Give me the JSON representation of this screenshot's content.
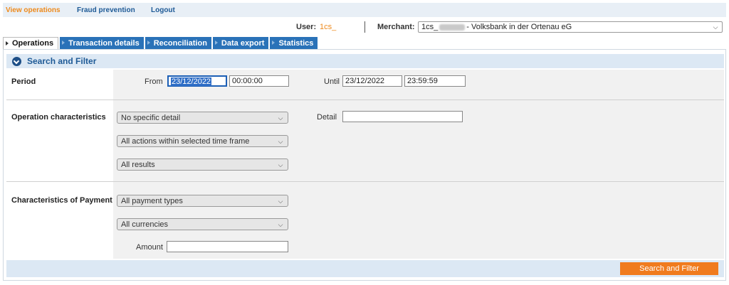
{
  "nav": {
    "items": [
      "View operations",
      "Fraud prevention",
      "Logout"
    ]
  },
  "user": {
    "label": "User:",
    "value": "1cs_"
  },
  "merchant": {
    "label": "Merchant:",
    "prefix": "1cs_",
    "suffix": "- Volksbank in der Ortenau eG"
  },
  "tabs": [
    "Operations",
    "Transaction details",
    "Reconciliation",
    "Data export",
    "Statistics"
  ],
  "search": {
    "header": "Search and Filter",
    "period": {
      "label": "Period",
      "from_label": "From",
      "from_date": "23/12/2022",
      "from_time": "00:00:00",
      "until_label": "Until",
      "until_date": "23/12/2022",
      "until_time": "23:59:59"
    },
    "operation": {
      "label": "Operation characteristics",
      "detail_select": "No specific detail",
      "actions_select": "All actions within selected time frame",
      "results_select": "All results",
      "detail_label": "Detail",
      "detail_value": ""
    },
    "payment": {
      "label": "Characteristics of Payment",
      "types_select": "All payment types",
      "currencies_select": "All currencies",
      "amount_label": "Amount",
      "amount_value": ""
    },
    "button": "Search and Filter"
  },
  "colors": {
    "accent_orange": "#f07b1e",
    "tab_blue": "#2a72b8",
    "header_bg": "#dce8f4"
  }
}
